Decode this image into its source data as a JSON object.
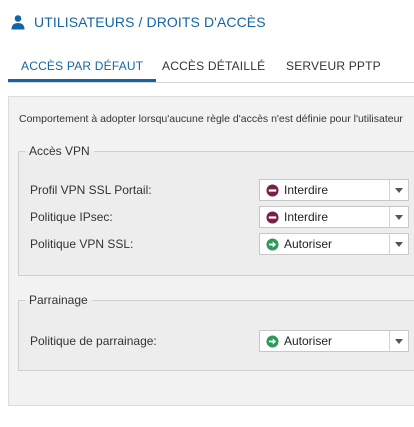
{
  "header": {
    "title": "UTILISATEURS / DROITS D'ACCÈS"
  },
  "tabs": [
    {
      "label": "ACCÈS PAR DÉFAUT",
      "active": true
    },
    {
      "label": "ACCÈS DÉTAILLÉ",
      "active": false
    },
    {
      "label": "SERVEUR PPTP",
      "active": false
    }
  ],
  "description": "Comportement à adopter lorsqu'aucune règle d'accès n'est définie pour l'utilisateur",
  "vpn_group": {
    "legend": "Accès VPN",
    "rows": [
      {
        "label": "Profil VPN SSL Portail:",
        "value": "Interdire",
        "status": "deny"
      },
      {
        "label": "Politique IPsec:",
        "value": "Interdire",
        "status": "deny"
      },
      {
        "label": "Politique VPN SSL:",
        "value": "Autoriser",
        "status": "allow"
      }
    ]
  },
  "sponsor_group": {
    "legend": "Parrainage",
    "rows": [
      {
        "label": "Politique de parrainage:",
        "value": "Autoriser",
        "status": "allow"
      }
    ]
  },
  "colors": {
    "accent": "#1565a6",
    "deny": "#7a1f4a",
    "allow": "#2e9a5a"
  },
  "icons": {
    "header": "user-icon",
    "deny": "deny-icon",
    "allow": "allow-arrow-icon",
    "dropdown": "chevron-down-icon"
  }
}
